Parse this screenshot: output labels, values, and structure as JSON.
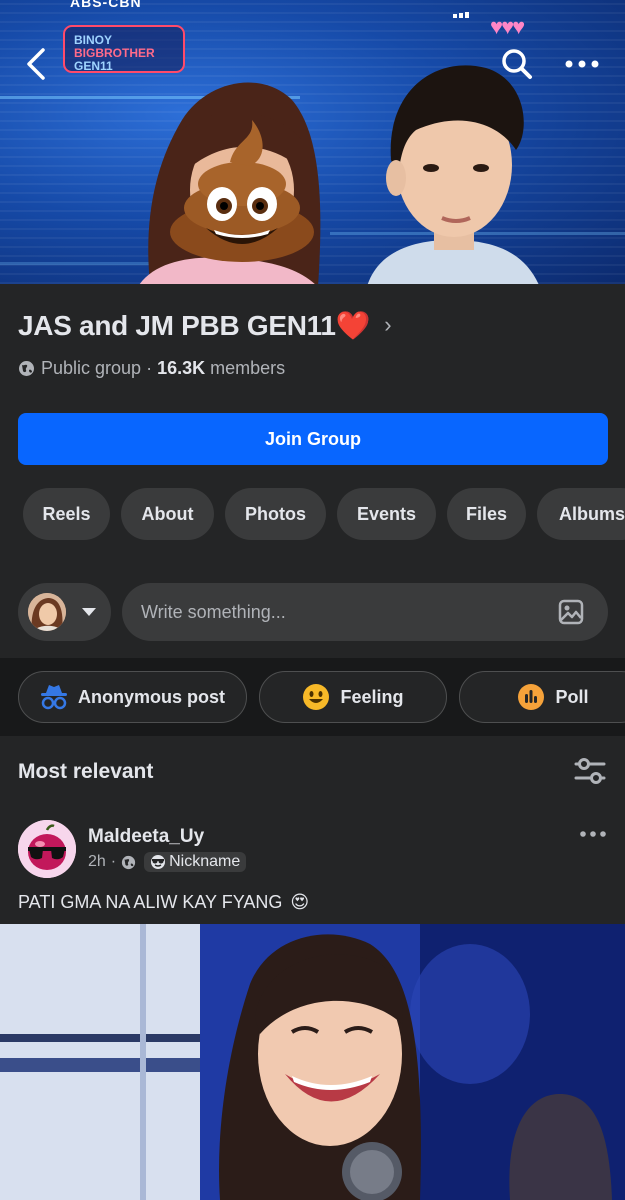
{
  "status_bar": {
    "top_text": "ABS-CBN"
  },
  "cover": {
    "logo_text": "BINOY BIG BROTHER GEN11",
    "hearts": "♥♥♥"
  },
  "nav": {
    "back_icon": "chevron-left-icon",
    "search_icon": "search-icon",
    "more_icon": "more-horizontal-icon"
  },
  "group": {
    "name": "JAS and JM PBB GEN11❤️",
    "privacy": "Public group",
    "member_count": "16.3K",
    "members_label": "members",
    "join_label": "Join Group"
  },
  "tabs": [
    {
      "label": "Reels"
    },
    {
      "label": "About"
    },
    {
      "label": "Photos"
    },
    {
      "label": "Events"
    },
    {
      "label": "Files"
    },
    {
      "label": "Albums"
    }
  ],
  "composer": {
    "placeholder": "Write something..."
  },
  "actions": [
    {
      "label": "Anonymous post",
      "icon": "anonymous-icon"
    },
    {
      "label": "Feeling",
      "icon": "smile-icon"
    },
    {
      "label": "Poll",
      "icon": "poll-icon"
    }
  ],
  "feed": {
    "sort_label": "Most relevant"
  },
  "post": {
    "author": "Maldeeta_Uy",
    "time": "2h",
    "badge": "Nickname",
    "text": "PATI GMA NA ALIW KAY FYANG",
    "text_emoji": "😍"
  },
  "colors": {
    "accent": "#0866ff",
    "background": "#242526",
    "surface": "#3a3b3c",
    "band": "#18191a"
  }
}
